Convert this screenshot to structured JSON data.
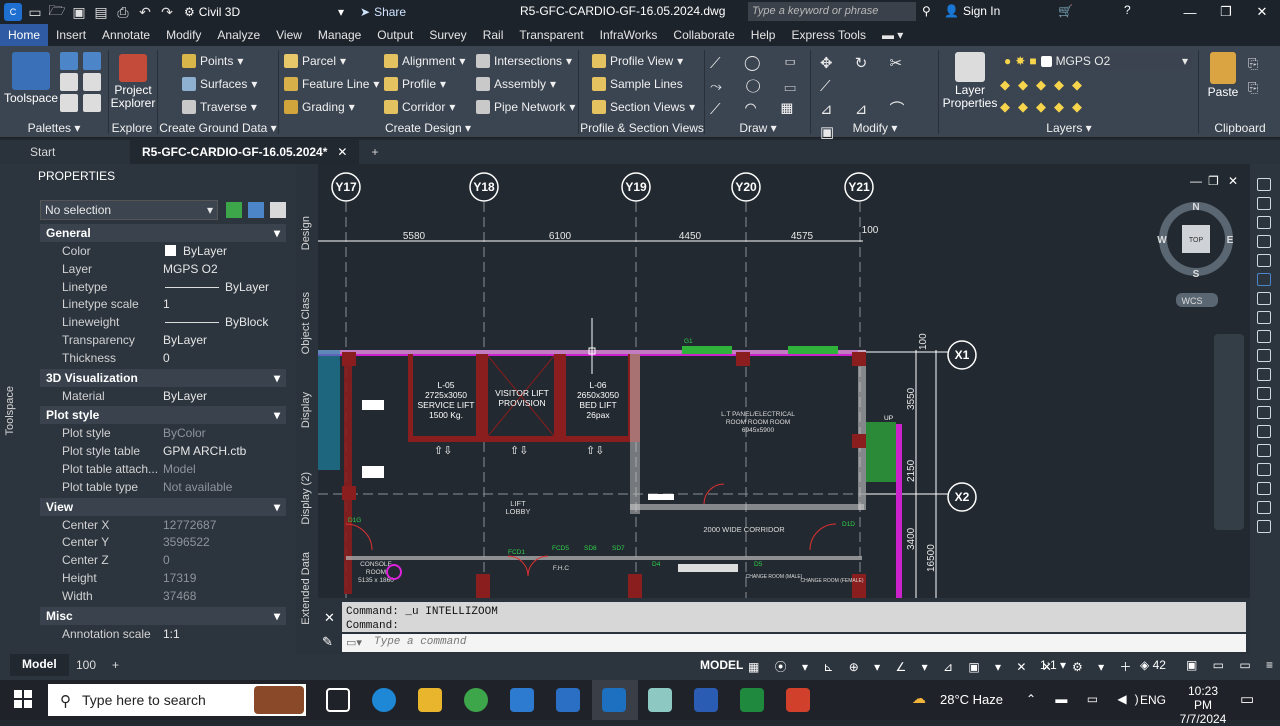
{
  "title_bar": {
    "app_label": "Civil 3D",
    "share_label": "Share",
    "file_name": "R5-GFC-CARDIO-GF-16.05.2024.dwg",
    "search_placeholder": "Type a keyword or phrase",
    "sign_in_label": "Sign In"
  },
  "menu_tabs": [
    "Home",
    "Insert",
    "Annotate",
    "Modify",
    "Analyze",
    "View",
    "Manage",
    "Output",
    "Survey",
    "Rail",
    "Transparent",
    "InfraWorks",
    "Collaborate",
    "Help",
    "Express Tools"
  ],
  "ribbon": {
    "toolspace_label": "Toolspace",
    "project_explorer_label": "Project Explorer",
    "layer_properties_label": "Layer Properties",
    "paste_label": "Paste",
    "layer_name": "MGPS O2",
    "ground_items": [
      "Points",
      "Surfaces",
      "Traverse"
    ],
    "design_col1": [
      "Parcel",
      "Feature Line",
      "Grading"
    ],
    "design_col2": [
      "Alignment",
      "Profile",
      "Corridor"
    ],
    "design_col3": [
      "Intersections",
      "Assembly",
      "Pipe Network"
    ],
    "profile_items": [
      "Profile View",
      "Sample Lines",
      "Section Views"
    ],
    "panel_labels": {
      "palettes": "Palettes",
      "explore": "Explore",
      "ground": "Create Ground Data",
      "design": "Create Design",
      "profile": "Profile & Section Views",
      "draw": "Draw",
      "modify": "Modify",
      "layers": "Layers",
      "clipboard": "Clipboard"
    }
  },
  "doc_tabs": {
    "start": "Start",
    "active": "R5-GFC-CARDIO-GF-16.05.2024*"
  },
  "properties": {
    "header": "PROPERTIES",
    "selection": "No selection",
    "sections": {
      "general": "General",
      "vis3d": "3D Visualization",
      "plot": "Plot style",
      "view": "View",
      "misc": "Misc"
    },
    "general": [
      {
        "k": "Color",
        "v": "ByLayer"
      },
      {
        "k": "Layer",
        "v": "MGPS O2"
      },
      {
        "k": "Linetype",
        "v": "ByLayer"
      },
      {
        "k": "Linetype scale",
        "v": "1"
      },
      {
        "k": "Lineweight",
        "v": "ByBlock"
      },
      {
        "k": "Transparency",
        "v": "ByLayer"
      },
      {
        "k": "Thickness",
        "v": "0"
      }
    ],
    "vis3d": [
      {
        "k": "Material",
        "v": "ByLayer"
      }
    ],
    "plot": [
      {
        "k": "Plot style",
        "v": "ByColor"
      },
      {
        "k": "Plot style table",
        "v": "GPM ARCH.ctb"
      },
      {
        "k": "Plot table attach...",
        "v": "Model"
      },
      {
        "k": "Plot table type",
        "v": "Not available"
      }
    ],
    "view": [
      {
        "k": "Center X",
        "v": "12772687"
      },
      {
        "k": "Center Y",
        "v": "3596522"
      },
      {
        "k": "Center Z",
        "v": "0"
      },
      {
        "k": "Height",
        "v": "17319"
      },
      {
        "k": "Width",
        "v": "37468"
      }
    ],
    "misc": [
      {
        "k": "Annotation scale",
        "v": "1:1"
      }
    ]
  },
  "vertical_tabs": [
    "Design",
    "Object Class",
    "Display",
    "Display (2)",
    "Extended Data"
  ],
  "toolspace_vertical": "Toolspace",
  "drawing": {
    "grid_bubbles_top": [
      "Y17",
      "Y18",
      "Y19",
      "Y20",
      "Y21"
    ],
    "grid_bubbles_right": [
      "X1",
      "X2"
    ],
    "dims_top": [
      "5580",
      "6100",
      "4450",
      "4575",
      "100"
    ],
    "dims_right": [
      "3550",
      "2150",
      "3400",
      "16500",
      "100"
    ],
    "room_lift_05": [
      "L-05",
      "2725x3050",
      "SERVICE LIFT",
      "1500 Kg."
    ],
    "room_visitor": [
      "VISITOR LIFT",
      "PROVISION"
    ],
    "room_lift_06": [
      "L-06",
      "2650x3050",
      "BED LIFT",
      "26pax"
    ],
    "room_lt": [
      "L.T PANEL/ELECTRICAL",
      "ROOM ROOM ROOM",
      "6945x5900"
    ],
    "lift_lobby": [
      "LIFT",
      "LOBBY"
    ],
    "corridor": "2000 WIDE CORRIDOR",
    "console": [
      "CONSOLE",
      "ROOM",
      "5135 x 1860"
    ],
    "fhc": "F.H.C",
    "labels_small": [
      "D1G",
      "D1D",
      "D4",
      "D5",
      "FCD1",
      "FCD5",
      "SD8",
      "SD7",
      "G1",
      "UP"
    ],
    "change_rooms": [
      "CHANGE ROOM (MALE)",
      "CHANGE ROOM (FEMALE)"
    ],
    "viewcube": {
      "n": "N",
      "s": "S",
      "e": "E",
      "w": "W",
      "top": "TOP",
      "wcs": "WCS"
    }
  },
  "command": {
    "line1": "Command: _u INTELLIZOOM",
    "line2": "Command:",
    "placeholder": "Type a command"
  },
  "status": {
    "model_tab": "Model",
    "layout_tab": "100",
    "model_label": "MODEL",
    "scale": "1:1",
    "count": "42"
  },
  "taskbar": {
    "search_placeholder": "Type here to search",
    "weather": "28°C  Haze",
    "lang": "ENG",
    "time": "10:23 PM",
    "date": "7/7/2024"
  }
}
